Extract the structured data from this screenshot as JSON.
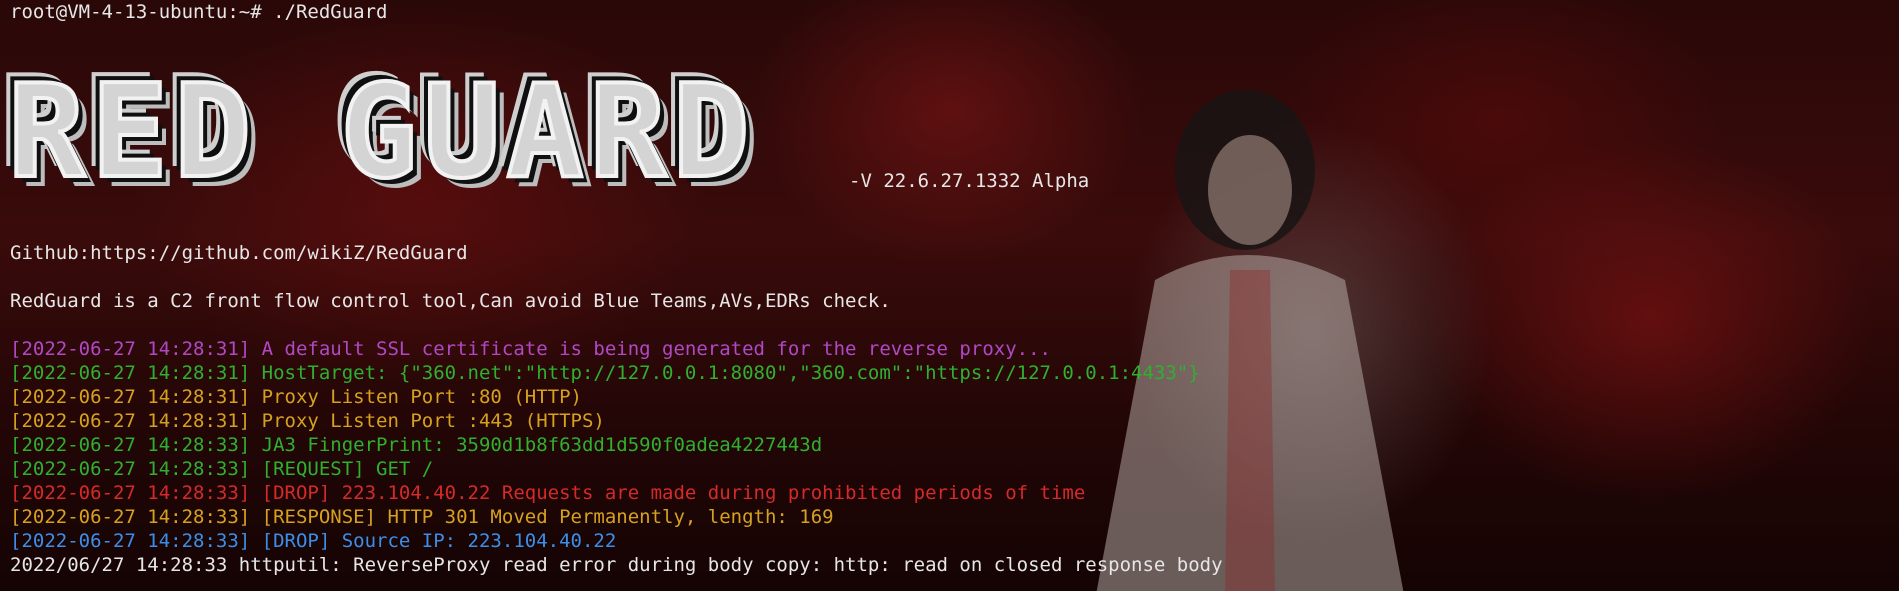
{
  "prompt": "root@VM-4-13-ubuntu:~# ./RedGuard",
  "banner": {
    "title": "RED GUARD",
    "version": "-V 22.6.27.1332 Alpha"
  },
  "github": "Github:https://github.com/wikiZ/RedGuard",
  "description": "RedGuard is a C2 front flow control tool,Can avoid Blue Teams,AVs,EDRs check.",
  "log": [
    {
      "ts": "[2022-06-27 14:28:31]",
      "msg": " A default SSL certificate is being generated for the reverse proxy...",
      "color": "#b148c6"
    },
    {
      "ts": "[2022-06-27 14:28:31]",
      "msg": " HostTarget: {\"360.net\":\"http://127.0.0.1:8080\",\"360.com\":\"https://127.0.0.1:4433\"}",
      "color": "#2fb02f"
    },
    {
      "ts": "[2022-06-27 14:28:31]",
      "msg": " Proxy Listen Port :80 (HTTP)",
      "color": "#d6a21e"
    },
    {
      "ts": "[2022-06-27 14:28:31]",
      "msg": " Proxy Listen Port :443 (HTTPS)",
      "color": "#d6a21e"
    },
    {
      "ts": "[2022-06-27 14:28:33]",
      "msg": " JA3 FingerPrint: 3590d1b8f63dd1d590f0adea4227443d",
      "color": "#2fb02f"
    },
    {
      "ts": "[2022-06-27 14:28:33]",
      "msg": " [REQUEST] GET /",
      "color": "#2fb02f"
    },
    {
      "ts": "[2022-06-27 14:28:33]",
      "msg": " [DROP] 223.104.40.22 Requests are made during prohibited periods of time",
      "color": "#d42a2a"
    },
    {
      "ts": "[2022-06-27 14:28:33]",
      "msg": " [RESPONSE] HTTP 301 Moved Permanently, length: 169",
      "color": "#d6a21e"
    },
    {
      "ts": "[2022-06-27 14:28:33]",
      "msg": " [DROP] Source IP: 223.104.40.22",
      "color": "#3b8eea"
    }
  ],
  "last_line": "2022/06/27 14:28:33 httputil: ReverseProxy read error during body copy: http: read on closed response body"
}
